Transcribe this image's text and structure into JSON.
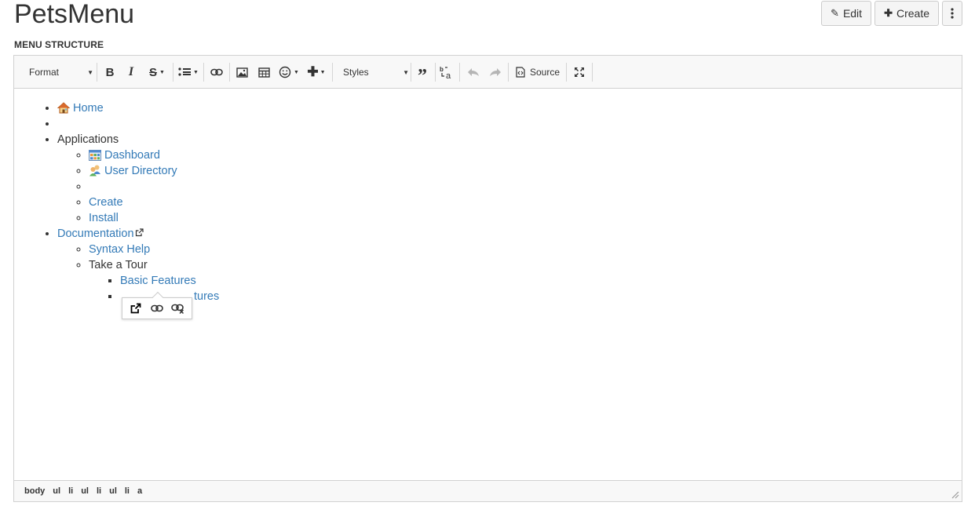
{
  "page": {
    "title": "PetsMenu"
  },
  "actions": {
    "edit": "Edit",
    "create": "Create"
  },
  "section": {
    "label": "MENU STRUCTURE"
  },
  "toolbar": {
    "format": "Format",
    "styles": "Styles",
    "source": "Source"
  },
  "menu": {
    "home": "Home",
    "applications": "Applications",
    "dashboard": "Dashboard",
    "user_directory": "User Directory",
    "create": "Create",
    "install": "Install",
    "documentation": "Documentation",
    "syntax_help": "Syntax Help",
    "take_a_tour": "Take a Tour",
    "basic_features": "Basic Features",
    "advanced_features_visible": "tures"
  },
  "statusbar": {
    "path": [
      "body",
      "ul",
      "li",
      "ul",
      "li",
      "ul",
      "li",
      "a"
    ]
  },
  "colors": {
    "link": "#337ab7",
    "toolbar_bg": "#f8f8f8",
    "border": "#d1d1d1"
  }
}
